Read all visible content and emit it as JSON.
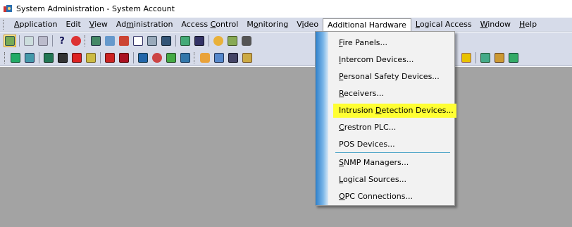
{
  "window": {
    "title": "System Administration - System Account"
  },
  "menubar": {
    "items": [
      {
        "id": "application",
        "label": "Application"
      },
      {
        "id": "edit",
        "label": "Edit"
      },
      {
        "id": "view",
        "label": "View"
      },
      {
        "id": "administration",
        "label": "Administration"
      },
      {
        "id": "access-control",
        "label": "Access Control"
      },
      {
        "id": "monitoring",
        "label": "Monitoring"
      },
      {
        "id": "video",
        "label": "Video"
      },
      {
        "id": "additional-hardware",
        "label": "Additional Hardware"
      },
      {
        "id": "logical-access",
        "label": "Logical Access"
      },
      {
        "id": "window",
        "label": "Window"
      },
      {
        "id": "help",
        "label": "Help"
      }
    ]
  },
  "dropdown": {
    "items": [
      {
        "label": "Fire Panels...",
        "highlighted": false
      },
      {
        "label": "Intercom Devices...",
        "highlighted": false
      },
      {
        "label": "Personal Safety Devices...",
        "highlighted": false
      },
      {
        "label": "Receivers...",
        "highlighted": false
      },
      {
        "label": "Intrusion Detection Devices...",
        "highlighted": true
      },
      {
        "label": "Crestron PLC...",
        "highlighted": false
      },
      {
        "label": "POS Devices...",
        "highlighted": false
      },
      {
        "label": "SNMP Managers...",
        "highlighted": false
      },
      {
        "label": "Logical Sources...",
        "highlighted": false
      },
      {
        "label": "OPC Connections...",
        "highlighted": false
      }
    ]
  },
  "toolbar1": {
    "icons": [
      "user-badge-icon",
      "print-preview-icon",
      "print-icon",
      "help-icon",
      "about-icon",
      "cardholders-icon",
      "badge-icon",
      "access-levels-icon",
      "reports-icon",
      "monitor-icon",
      "alarms-icon",
      "users-icon",
      "devices-icon",
      "gear-icon",
      "video-icon"
    ]
  },
  "toolbar2": {
    "icons": [
      "tree-icon",
      "map-icon",
      "panel-icon",
      "reader-icon",
      "input-icon",
      "camera-icon",
      "alarm-icon",
      "door-icon",
      "sensor-icon",
      "network-icon",
      "chart-icon",
      "bell-icon",
      "lock-icon",
      "person-icon",
      "key-icon",
      "zone-icon",
      "monitor-station-icon",
      "link-icon"
    ]
  },
  "colors": {
    "highlight": "#ffff33",
    "workspace": "#a3a3a3",
    "menubar": "#d6dbe9",
    "strip": "#2e7fc9"
  }
}
